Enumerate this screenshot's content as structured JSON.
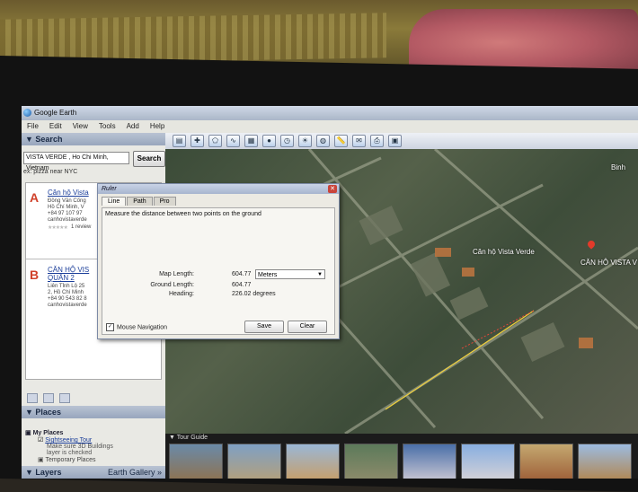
{
  "app": {
    "title": "Google Earth"
  },
  "menu": [
    "File",
    "Edit",
    "View",
    "Tools",
    "Add",
    "Help"
  ],
  "search": {
    "header": "Search",
    "query": "VISTA VERDE , Ho Chi Minh, Vietnam",
    "button": "Search",
    "hint": "ex: pizza near NYC",
    "results": [
      {
        "letter": "A",
        "title": "Căn hộ Vista",
        "lines": [
          "Đồng Văn Cống",
          "Hồ Chí Minh, V",
          "+84 97 107 97",
          "canhovistaverde"
        ],
        "reviews": "1 review"
      },
      {
        "letter": "B",
        "title": "CĂN HỘ VIS",
        "title2": "QUẬN 2",
        "lines": [
          "Liên Tỉnh Lộ 25",
          "2, Hồ Chí Minh",
          "+84 90 543 82 8",
          "canhovistaverde"
        ]
      }
    ]
  },
  "places": {
    "header": "Places",
    "my_places": "My Places",
    "tour": "Sightseeing Tour",
    "note1": "Make sure 3D Buildings",
    "note2": "layer is checked",
    "temp": "Temporary Places"
  },
  "layers": {
    "header": "Layers",
    "gallery": "Earth Gallery »"
  },
  "ruler": {
    "title": "Ruler",
    "tabs": [
      "Line",
      "Path",
      "Pro"
    ],
    "description": "Measure the distance between two points on the ground",
    "map_length_label": "Map Length:",
    "map_length_value": "604.77",
    "units": "Meters",
    "ground_length_label": "Ground Length:",
    "ground_length_value": "604.77",
    "heading_label": "Heading:",
    "heading_value": "226.02 degrees",
    "mouse_nav": "Mouse Navigation",
    "save": "Save",
    "clear": "Clear"
  },
  "map": {
    "label1": "Căn hộ Vista Verde",
    "label2": "CĂN HỘ VISTA V",
    "corner": "Binh"
  },
  "tour_guide": {
    "header": "Tour Guide"
  },
  "colors": {
    "ruler_line": "#f2d23a",
    "pin": "#e23a2a",
    "link": "#1a3d99"
  }
}
